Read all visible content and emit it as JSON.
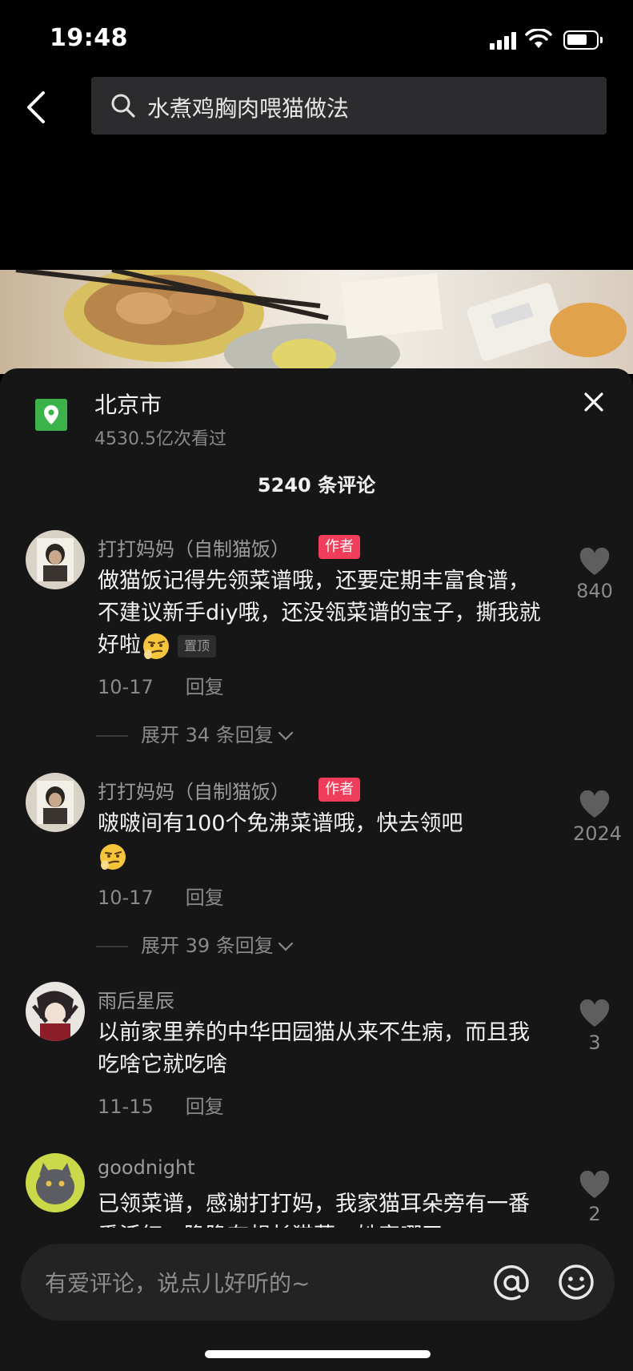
{
  "status": {
    "time": "19:48"
  },
  "search": {
    "query": "水煮鸡胸肉喂猫做法"
  },
  "location": {
    "title": "北京市",
    "views": "4530.5亿次看过"
  },
  "comment_count": "5240 条评论",
  "author_tag": "作者",
  "pinned_tag": "置顶",
  "reply_label": "回复",
  "comments": [
    {
      "name": "打打妈妈（自制猫饭）",
      "text": "做猫饭记得先领菜谱哦，还要定期丰富食谱，不建议新手diy哦，还没瓴菜谱的宝子，撕我就好啦",
      "date": "10-17",
      "likes": "840",
      "expand": "展开 34 条回复"
    },
    {
      "name": "打打妈妈（自制猫饭）",
      "text": "啵啵间有100个免沸菜谱哦，快去领吧",
      "date": "10-17",
      "likes": "2024",
      "expand": "展开 39 条回复"
    },
    {
      "name": "雨后星辰",
      "text": "以前家里养的中华田园猫从来不生病，而且我吃啥它就吃啥",
      "date": "11-15",
      "likes": "3"
    },
    {
      "name": "goodnight",
      "text": "已领菜谱，感谢打打妈，我家猫耳朵旁有一番番活红，隐隐有想长猫藓，她家哪了",
      "likes": "2"
    }
  ],
  "input": {
    "placeholder": "有爱评论，说点儿好听的~"
  },
  "icons": {
    "location": "location-pin-icon",
    "like": "heart-icon",
    "close": "close-icon",
    "at": "at-icon",
    "emoji": "emoji-icon"
  },
  "colors": {
    "author_tag": "#f03e5a",
    "location": "#3bb34a",
    "sheet": "#161616"
  }
}
